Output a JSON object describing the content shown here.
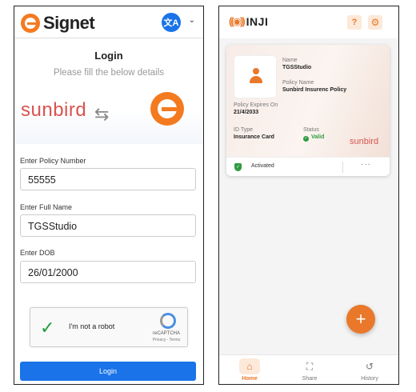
{
  "signet": {
    "brand": "Signet",
    "language_icon": "translate-icon",
    "login_title": "Login",
    "login_subtitle": "Please fill the below details",
    "partner_brand": "sunbird",
    "swap_icon": "⇆",
    "fields": {
      "policy_number": {
        "label": "Enter Policy Number",
        "value": "55555"
      },
      "full_name": {
        "label": "Enter Full Name",
        "value": "TGSStudio"
      },
      "dob": {
        "label": "Enter DOB",
        "value": "26/01/2000"
      }
    },
    "captcha": {
      "label": "I'm not a robot",
      "brand": "reCAPTCHA",
      "links": "Privacy - Terms",
      "checked": true
    },
    "login_button": "Login",
    "colors": {
      "accent": "#1a73e8",
      "logo": "#f47a20"
    }
  },
  "inji": {
    "brand": "INJI",
    "help_icon": "?",
    "settings_icon": "gear-icon",
    "card": {
      "name_label": "Name",
      "name_value": "TGSStudio",
      "policy_label": "Policy Name",
      "policy_value": "Sunbird Insurenc Policy",
      "expires_label": "Policy Expires On",
      "expires_value": "21/4/2033",
      "id_type_label": "ID Type",
      "id_type_value": "Insurance Card",
      "status_label": "Status",
      "status_value": "Valid",
      "issuer_logo": "sunbird",
      "activated_label": "Activated",
      "menu": "···"
    },
    "fab_label": "+",
    "nav": [
      {
        "label": "Home",
        "icon": "home-icon",
        "active": true
      },
      {
        "label": "Share",
        "icon": "scan-icon",
        "active": false
      },
      {
        "label": "History",
        "icon": "history-icon",
        "active": false
      }
    ],
    "colors": {
      "accent": "#e9782a",
      "valid": "#2e9b41"
    }
  }
}
